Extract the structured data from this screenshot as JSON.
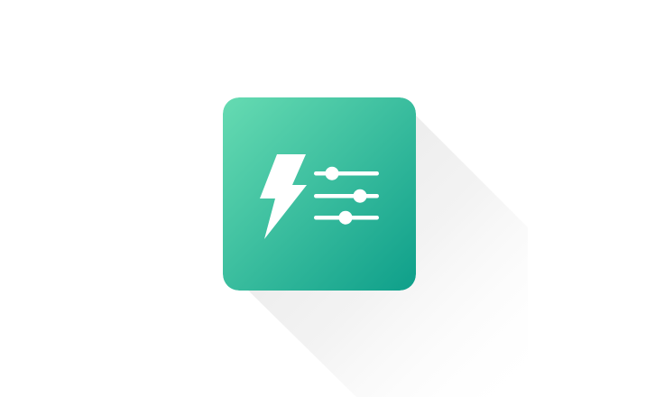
{
  "app_icon": {
    "name": "power-settings-app-icon",
    "icons": [
      "lightning-bolt-icon",
      "sliders-icon"
    ],
    "colors": {
      "background": "#ffffff",
      "gradient_start": "#66dbb2",
      "gradient_end": "#0e9f8a",
      "glyph": "#ffffff",
      "shadow": "#e9e9e9"
    }
  }
}
